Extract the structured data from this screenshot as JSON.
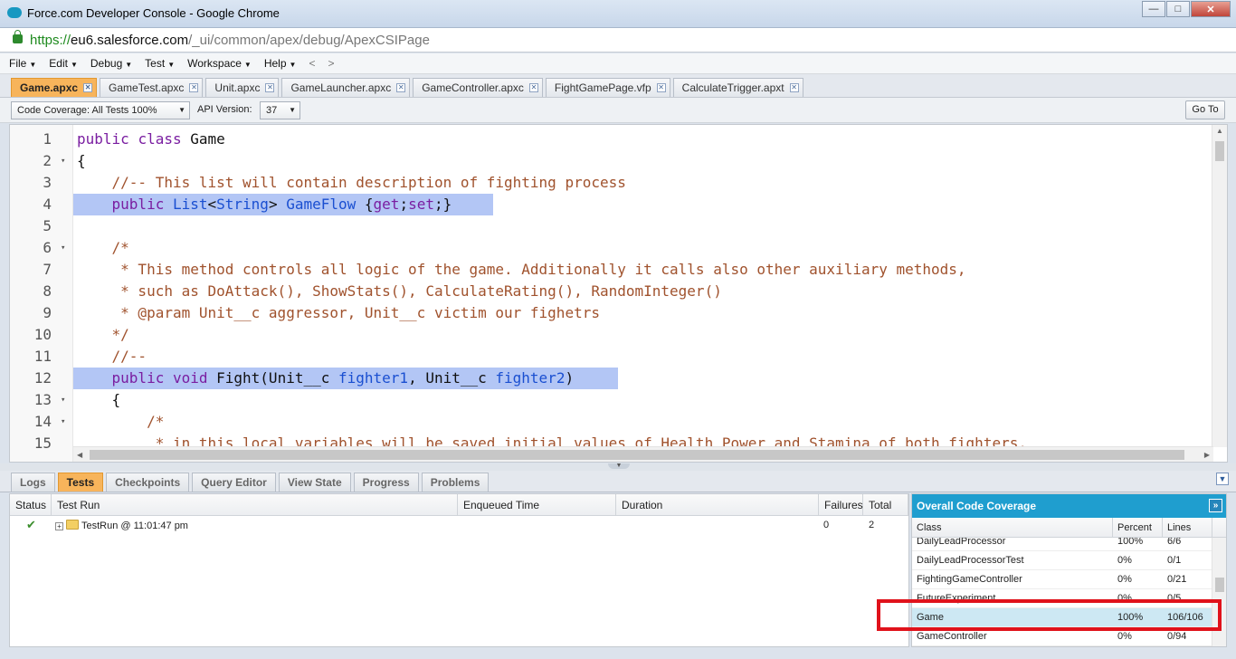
{
  "window": {
    "title": "Force.com Developer Console - Google Chrome"
  },
  "address": {
    "scheme": "https://",
    "host": "eu6.salesforce.com",
    "path": "/_ui/common/apex/debug/ApexCSIPage"
  },
  "menu": {
    "items": [
      "File",
      "Edit",
      "Debug",
      "Test",
      "Workspace",
      "Help"
    ],
    "back": "<",
    "forward": ">"
  },
  "file_tabs": [
    "Game.apxc",
    "GameTest.apxc",
    "Unit.apxc",
    "GameLauncher.apxc",
    "GameController.apxc",
    "FightGamePage.vfp",
    "CalculateTrigger.apxt"
  ],
  "toolbar": {
    "coverage_select": "Code Coverage: All Tests 100%",
    "api_label": "API Version:",
    "api_value": "37",
    "goto_label": "Go To"
  },
  "code": {
    "lines": [
      {
        "n": "1",
        "fold": "",
        "text": "public class Game"
      },
      {
        "n": "2",
        "fold": "▾",
        "text": "{"
      },
      {
        "n": "3",
        "fold": "",
        "text": "    //-- This list will contain description of fighting process"
      },
      {
        "n": "4",
        "fold": "",
        "text": "    public List<String> GameFlow {get;set;}"
      },
      {
        "n": "5",
        "fold": "",
        "text": ""
      },
      {
        "n": "6",
        "fold": "▾",
        "text": "    /*"
      },
      {
        "n": "7",
        "fold": "",
        "text": "     * This method controls all logic of the game. Additionally it calls also other auxiliary methods,"
      },
      {
        "n": "8",
        "fold": "",
        "text": "     * such as DoAttack(), ShowStats(), CalculateRating(), RandomInteger()"
      },
      {
        "n": "9",
        "fold": "",
        "text": "     * @param Unit__c aggressor, Unit__c victim our fighetrs"
      },
      {
        "n": "10",
        "fold": "",
        "text": "    */"
      },
      {
        "n": "11",
        "fold": "",
        "text": "    //--"
      },
      {
        "n": "12",
        "fold": "",
        "text": "    public void Fight(Unit__c fighter1, Unit__c fighter2)"
      },
      {
        "n": "13",
        "fold": "▾",
        "text": "    {"
      },
      {
        "n": "14",
        "fold": "▾",
        "text": "        /*"
      },
      {
        "n": "15",
        "fold": "",
        "text": "         * in this local variables will be saved initial values of Health Power and Stamina of both fighters."
      }
    ]
  },
  "panel_tabs": [
    "Logs",
    "Tests",
    "Checkpoints",
    "Query Editor",
    "View State",
    "Progress",
    "Problems"
  ],
  "tests_grid": {
    "headers": [
      "Status",
      "Test Run",
      "Enqueued Time",
      "Duration",
      "Failures",
      "Total"
    ],
    "rows": [
      {
        "status": "✔",
        "name": "TestRun @ 11:01:47 pm",
        "enqueued": "",
        "duration": "",
        "failures": "0",
        "total": "2"
      }
    ]
  },
  "coverage": {
    "title": "Overall Code Coverage",
    "headers": [
      "Class",
      "Percent",
      "Lines"
    ],
    "rows": [
      {
        "cls": "DailyLeadProcessor",
        "pct": "100%",
        "lines": "6/6"
      },
      {
        "cls": "DailyLeadProcessorTest",
        "pct": "0%",
        "lines": "0/1"
      },
      {
        "cls": "FightingGameController",
        "pct": "0%",
        "lines": "0/21"
      },
      {
        "cls": "FutureExperiment",
        "pct": "0%",
        "lines": "0/5"
      },
      {
        "cls": "Game",
        "pct": "100%",
        "lines": "106/106"
      },
      {
        "cls": "GameController",
        "pct": "0%",
        "lines": "0/94"
      }
    ]
  }
}
